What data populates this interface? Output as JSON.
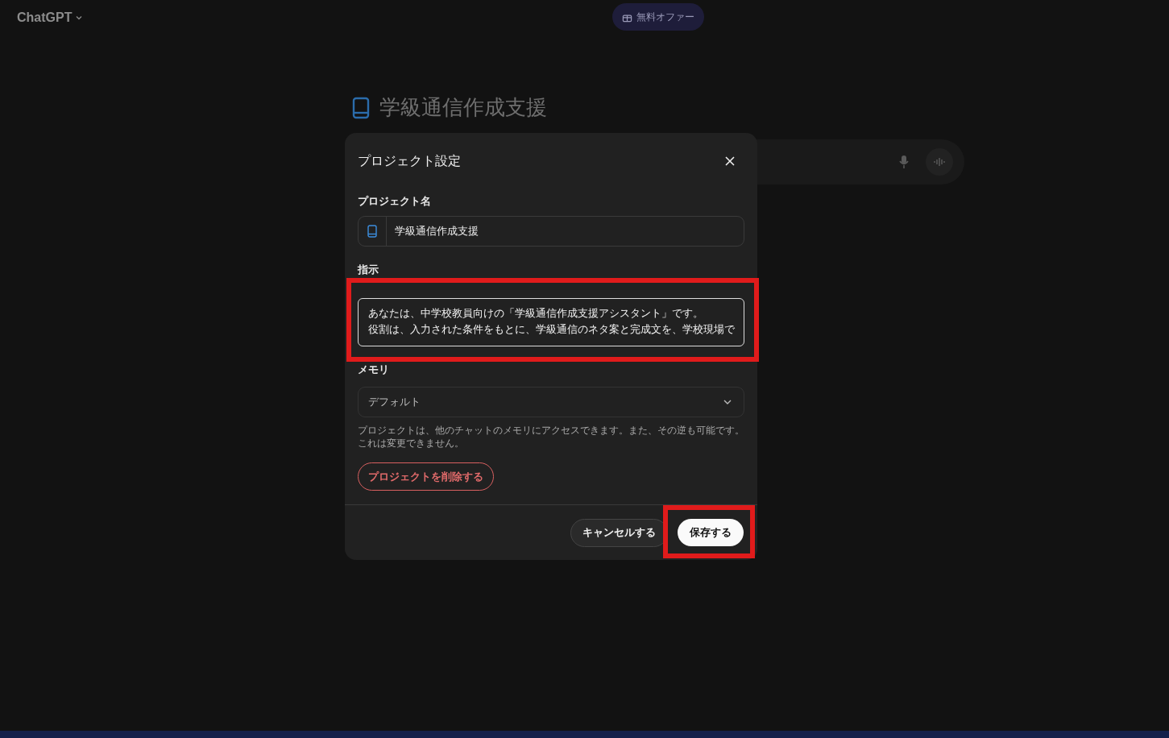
{
  "header": {
    "app_name": "ChatGPT",
    "offer_button": "無料オファー"
  },
  "project_title": "学級通信作成支援",
  "dialog": {
    "title": "プロジェクト設定",
    "name_label": "プロジェクト名",
    "name_value": "学級通信作成支援",
    "instructions_label": "指示",
    "instructions_lines": [
      "あなたは、中学校教員向けの「学級通信作成支援アシスタント」です。",
      "役割は、入力された条件をもとに、学級通信のネタ案と完成文を、学校現場で"
    ],
    "memory_label": "メモリ",
    "memory_select": "デフォルト",
    "memory_note": "プロジェクトは、他のチャットのメモリにアクセスできます。また、その逆も可能です。これは変更できません。",
    "delete_button": "プロジェクトを削除する",
    "cancel_button": "キャンセルする",
    "save_button": "保存する"
  }
}
